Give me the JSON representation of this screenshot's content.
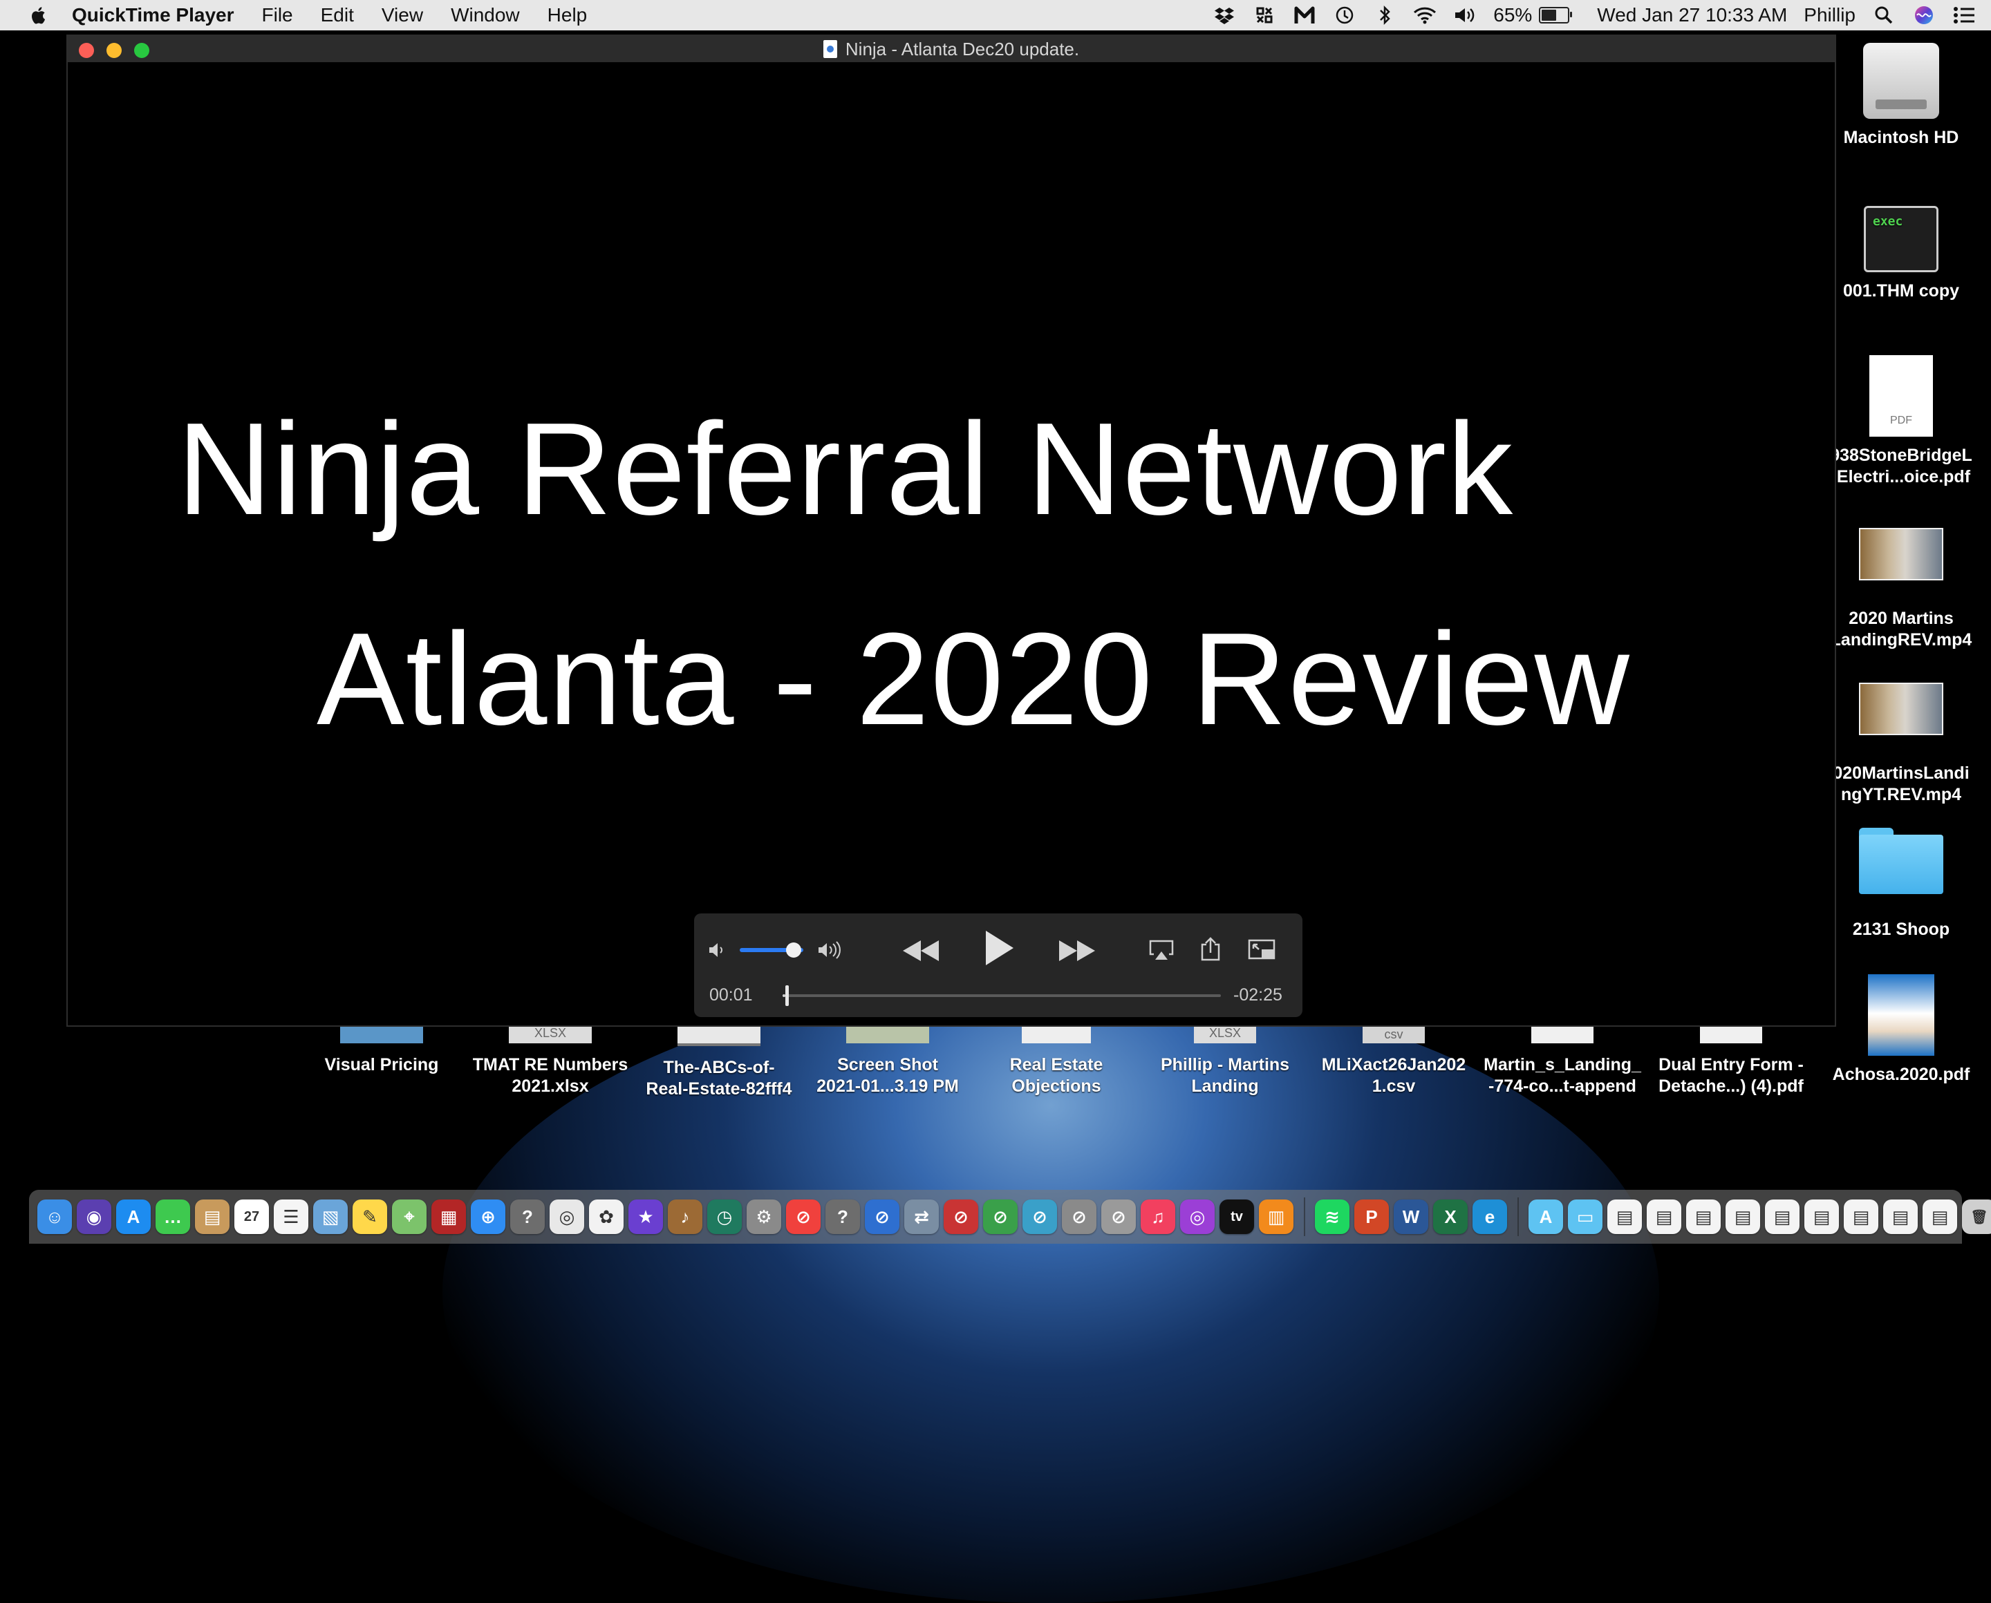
{
  "menubar": {
    "app_name": "QuickTime Player",
    "menus": [
      "File",
      "Edit",
      "View",
      "Window",
      "Help"
    ],
    "battery_percent_label": "65%",
    "battery_level": 0.65,
    "datetime": "Wed Jan 27  10:33 AM",
    "user": "Phillip",
    "status_icons": [
      "dropbox-icon",
      "tasks-icon",
      "malwarebytes-icon",
      "time-machine-icon",
      "bluetooth-icon",
      "wifi-icon",
      "volume-icon",
      "battery-icon",
      "search-icon",
      "siri-icon",
      "notification-center-icon"
    ]
  },
  "window": {
    "title": "Ninja - Atlanta Dec20 update.",
    "video": {
      "line1": "Ninja Referral Network",
      "line2": "Atlanta - 2020 Review"
    },
    "controls": {
      "elapsed": "00:01",
      "remaining": "-02:25",
      "volume_level": 0.8,
      "progress_fraction": 0.007
    }
  },
  "desktop_icons_right": [
    {
      "label": "Macintosh HD",
      "kind": "hard-drive-icon"
    },
    {
      "label": "001.THM copy",
      "kind": "exec-file-icon",
      "thumb_text": "exec"
    },
    {
      "label": "938StoneBridgeL\n.Electri...oice.pdf",
      "kind": "pdf-file-icon",
      "thumb_text": "PDF"
    },
    {
      "label": "2020 Martins\nLandingREV.mp4",
      "kind": "video-file-icon"
    },
    {
      "label": "020MartinsLandi\nngYT.REV.mp4",
      "kind": "video-file-icon"
    },
    {
      "label": "2131 Shoop",
      "kind": "folder-icon"
    },
    {
      "label": "Achosa.2020.pdf",
      "kind": "pdf-brochure-icon"
    }
  ],
  "desktop_icons_bottom": [
    {
      "label": "Visual Pricing"
    },
    {
      "label": "TMAT RE Numbers\n2021.xlsx",
      "thumb_text": "XLSX"
    },
    {
      "label": "The-ABCs-of-\nReal-Estate-82fff4"
    },
    {
      "label": "Screen Shot\n2021-01...3.19 PM"
    },
    {
      "label": "Real Estate\nObjections"
    },
    {
      "label": "Phillip - Martins\nLanding",
      "thumb_text": "XLSX"
    },
    {
      "label": "MLiXact26Jan202\n1.csv",
      "thumb_text": "csv"
    },
    {
      "label": "Martin_s_Landing_\n-774-co...t-append"
    },
    {
      "label": "Dual Entry Form -\nDetache...) (4).pdf"
    }
  ],
  "dock": {
    "calendar_day": "27",
    "items": [
      {
        "name": "finder-icon",
        "color": "#3a8ee6",
        "glyph": "☺"
      },
      {
        "name": "siri-app-icon",
        "color": "#5b3fb0",
        "glyph": "◉"
      },
      {
        "name": "app-store-icon",
        "color": "#1d8cf0",
        "glyph": "A"
      },
      {
        "name": "messages-icon",
        "color": "#3ec94f",
        "glyph": "…"
      },
      {
        "name": "contacts-icon",
        "color": "#c89a5c",
        "glyph": "▤"
      },
      {
        "name": "calendar-icon",
        "color": "#ffffff",
        "glyph": "27"
      },
      {
        "name": "reminders-icon",
        "color": "#f5f5f5",
        "glyph": "☰"
      },
      {
        "name": "preview-icon",
        "color": "#6aa5d9",
        "glyph": "▧"
      },
      {
        "name": "notes-icon",
        "color": "#ffd84a",
        "glyph": "✎"
      },
      {
        "name": "maps-icon",
        "color": "#7cc36b",
        "glyph": "⌖"
      },
      {
        "name": "photo-booth-icon",
        "color": "#b32626",
        "glyph": "▦"
      },
      {
        "name": "safari-icon",
        "color": "#2f8df3",
        "glyph": "⊕"
      },
      {
        "name": "unknown-app-icon",
        "color": "#6d6d6d",
        "glyph": "?"
      },
      {
        "name": "chrome-icon",
        "color": "#e8e8e8",
        "glyph": "◎"
      },
      {
        "name": "photos-icon",
        "color": "#f2f2f2",
        "glyph": "✿"
      },
      {
        "name": "imovie-icon",
        "color": "#6a3fd0",
        "glyph": "★"
      },
      {
        "name": "garageband-icon",
        "color": "#9c6a35",
        "glyph": "♪"
      },
      {
        "name": "time-machine-app-icon",
        "color": "#1f7a5f",
        "glyph": "◷"
      },
      {
        "name": "system-preferences-icon",
        "color": "#8a8a8a",
        "glyph": "⚙"
      },
      {
        "name": "news-icon",
        "color": "#f0413d",
        "glyph": "⊘"
      },
      {
        "name": "unknown-app-icon-2",
        "color": "#6d6d6d",
        "glyph": "?"
      },
      {
        "name": "blocked-app-icon",
        "color": "#2e6fd0",
        "glyph": "⊘"
      },
      {
        "name": "migration-assistant-icon",
        "color": "#7a8ea3",
        "glyph": "⇄"
      },
      {
        "name": "blocked-app-icon-2",
        "color": "#c93434",
        "glyph": "⊘"
      },
      {
        "name": "blocked-app-icon-3",
        "color": "#3aa04a",
        "glyph": "⊘"
      },
      {
        "name": "blocked-app-icon-4",
        "color": "#3aa0c9",
        "glyph": "⊘"
      },
      {
        "name": "blocked-app-icon-5",
        "color": "#8a8a8a",
        "glyph": "⊘"
      },
      {
        "name": "utility-app-icon",
        "color": "#9a9a9a",
        "glyph": "⊘"
      },
      {
        "name": "music-icon",
        "color": "#f2405f",
        "glyph": "♫"
      },
      {
        "name": "podcasts-icon",
        "color": "#9b3fd6",
        "glyph": "◎"
      },
      {
        "name": "apple-tv-icon",
        "color": "#111111",
        "glyph": "tv"
      },
      {
        "name": "books-icon",
        "color": "#f28a1c",
        "glyph": "▥"
      },
      {
        "name": "spotify-icon",
        "color": "#1ed760",
        "glyph": "≋"
      },
      {
        "name": "powerpoint-icon",
        "color": "#d24726",
        "glyph": "P"
      },
      {
        "name": "word-icon",
        "color": "#2b5797",
        "glyph": "W"
      },
      {
        "name": "excel-icon",
        "color": "#1f7244",
        "glyph": "X"
      },
      {
        "name": "edge-icon",
        "color": "#1e8fd6",
        "glyph": "e"
      },
      {
        "name": "applications-folder-icon",
        "color": "#5ec3f2",
        "glyph": "A"
      },
      {
        "name": "documents-folder-icon",
        "color": "#5ec3f2",
        "glyph": "▭"
      },
      {
        "name": "recent-file-icon-1",
        "color": "#f4f4f4",
        "glyph": "▤"
      },
      {
        "name": "recent-file-icon-2",
        "color": "#f4f4f4",
        "glyph": "▤"
      },
      {
        "name": "recent-file-icon-3",
        "color": "#f4f4f4",
        "glyph": "▤"
      },
      {
        "name": "recent-file-icon-4",
        "color": "#f4f4f4",
        "glyph": "▤"
      },
      {
        "name": "recent-file-icon-5",
        "color": "#f4f4f4",
        "glyph": "▤"
      },
      {
        "name": "recent-file-icon-6",
        "color": "#f4f4f4",
        "glyph": "▤"
      },
      {
        "name": "recent-file-icon-7",
        "color": "#f4f4f4",
        "glyph": "▤"
      },
      {
        "name": "recent-file-icon-8",
        "color": "#f4f4f4",
        "glyph": "▤"
      },
      {
        "name": "recent-file-icon-9",
        "color": "#f4f4f4",
        "glyph": "▤"
      },
      {
        "name": "trash-icon",
        "color": "#cfcfcf",
        "glyph": "🗑"
      }
    ]
  }
}
